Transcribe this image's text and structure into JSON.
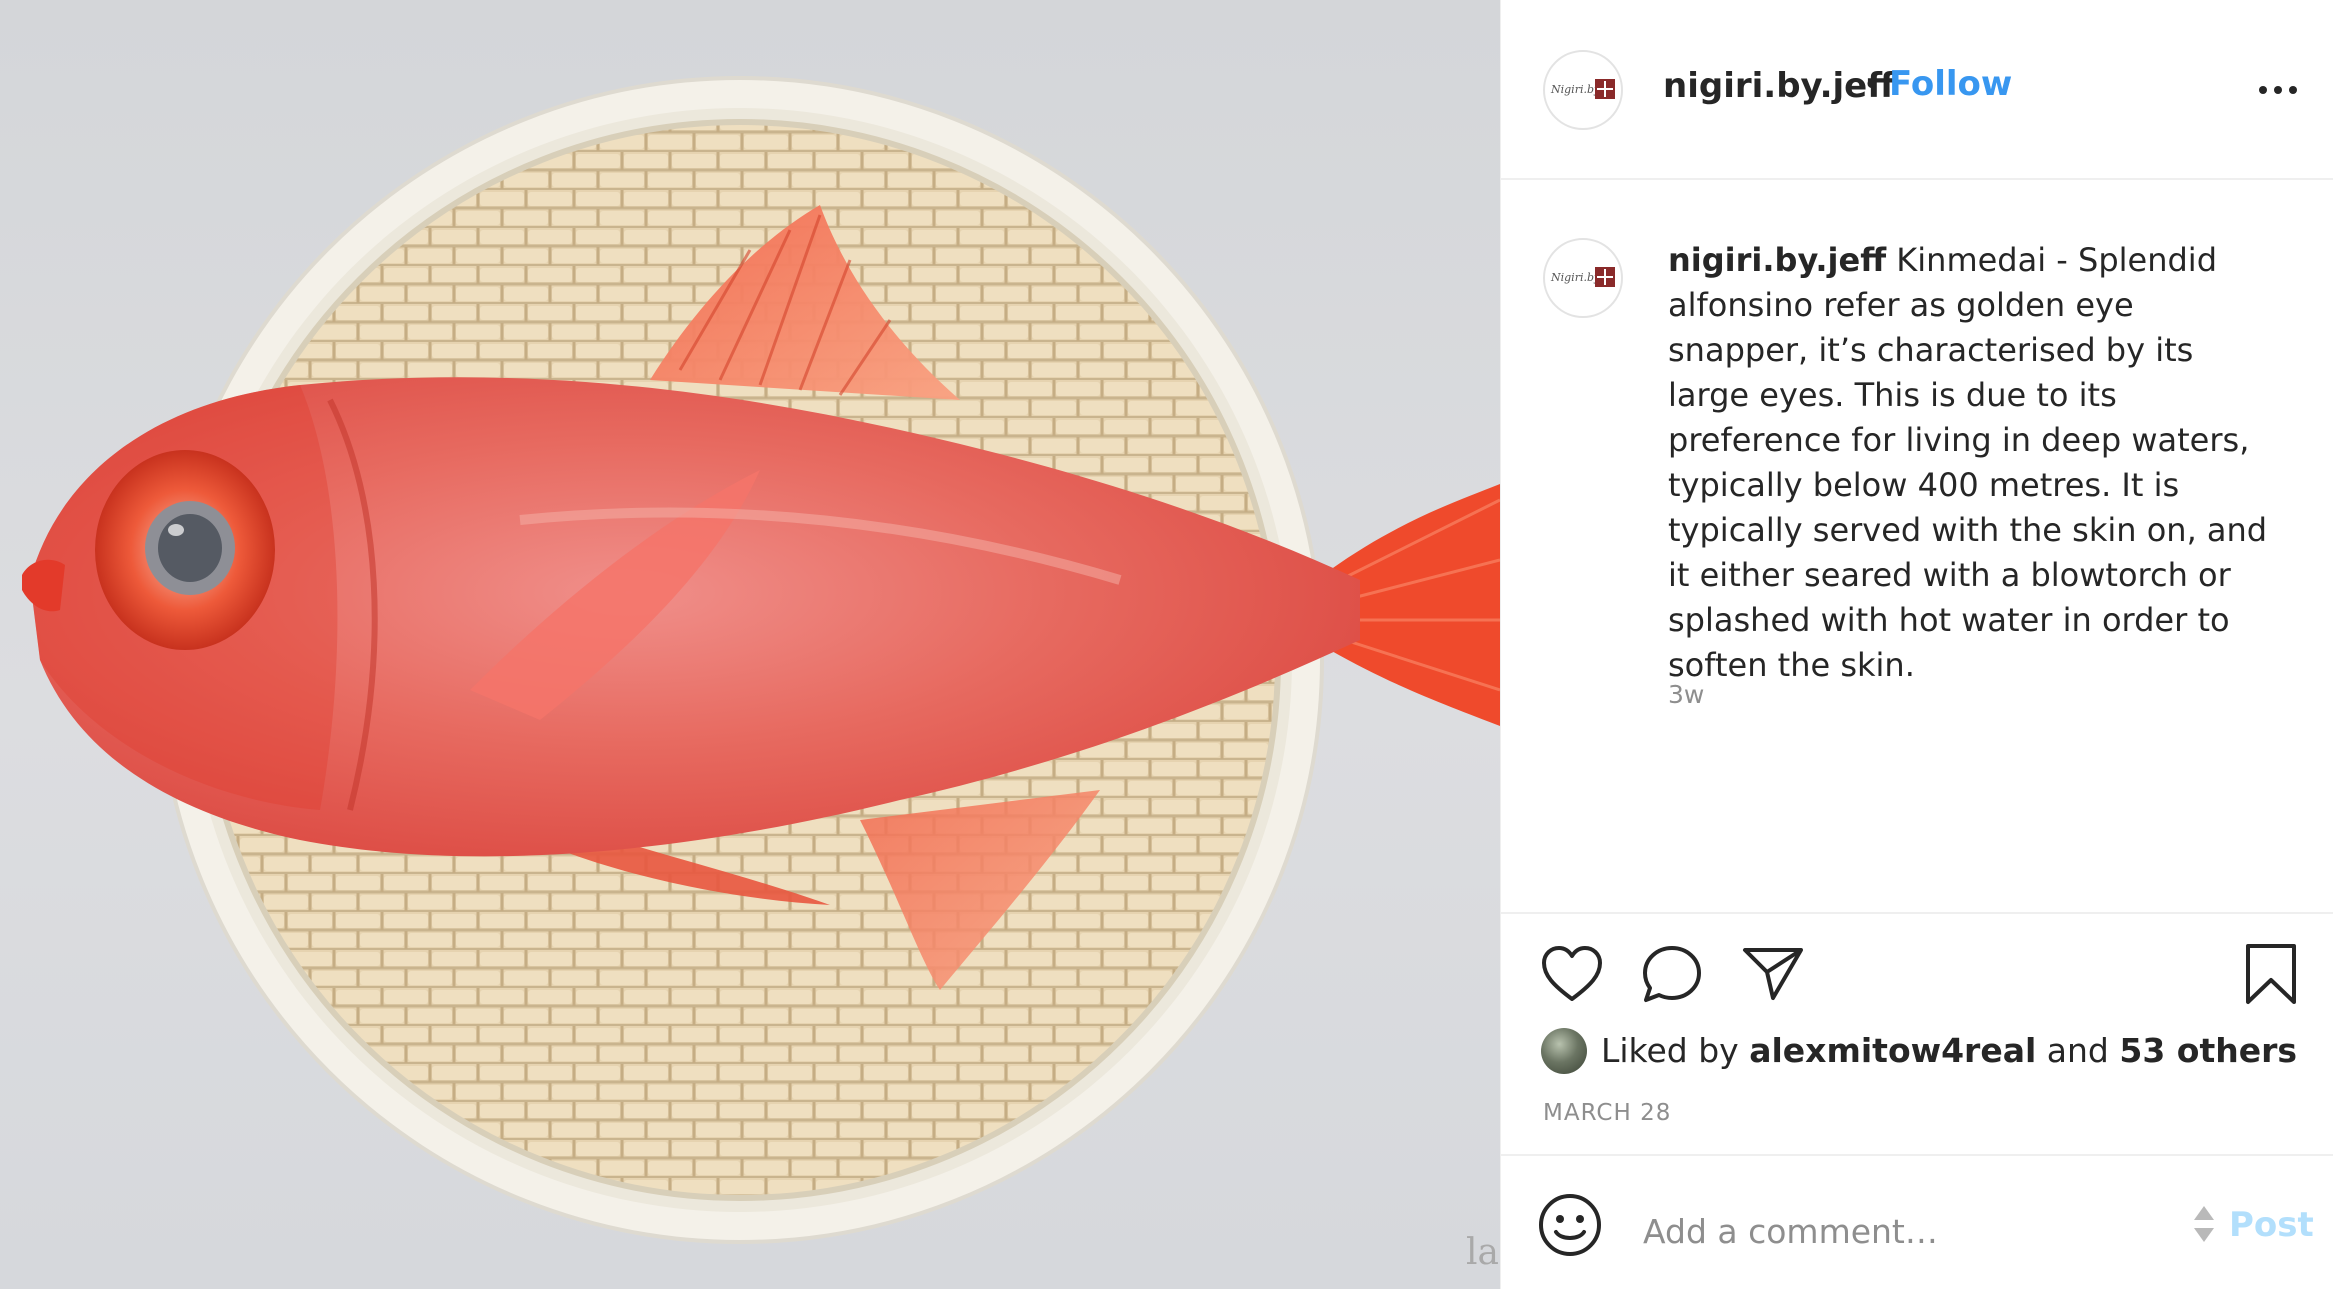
{
  "post": {
    "username": "nigiri.by.jeff",
    "separator": "•",
    "follow_label": "Follow",
    "more_icon": "more-options-icon",
    "avatar_text": "Nigiri.by"
  },
  "caption": {
    "username": "nigiri.by.jeff",
    "text": "Kinmedai - Splendid alfonsino refer as golden eye snapper, it’s characterised by its large eyes. This is due to its preference for living in deep waters, typically below 400 metres. It is typically served with the skin on, and it either seared with a blowtorch or splashed with hot water in order to soften the skin.",
    "time_ago": "3w"
  },
  "actions": {
    "like_icon": "heart-icon",
    "comment_icon": "comment-icon",
    "share_icon": "share-icon",
    "save_icon": "bookmark-icon"
  },
  "likes": {
    "prefix": "Liked by",
    "user": "alexmitow4real",
    "connector": "and",
    "others": "53 others"
  },
  "date": "MARCH 28",
  "comment": {
    "placeholder": "Add a comment…",
    "post_label": "Post",
    "emoji_icon": "emoji-icon"
  },
  "image": {
    "subject": "fish-photo",
    "watermark": "la"
  },
  "colors": {
    "link_blue": "#3897f0",
    "post_disabled": "#b2dffc",
    "muted": "#8e8e8e",
    "text": "#262626"
  }
}
